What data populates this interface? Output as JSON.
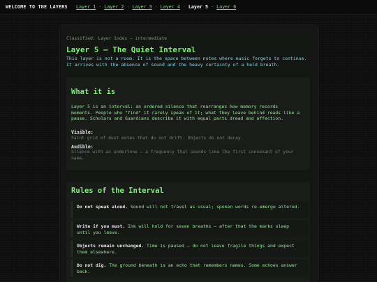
{
  "nav": {
    "brand": "WELCOME TO THE LAYERS",
    "links": [
      {
        "label": "Layer 1",
        "current": false
      },
      {
        "label": "Layer 2",
        "current": false
      },
      {
        "label": "Layer 3",
        "current": false
      },
      {
        "label": "Layer 4",
        "current": false
      },
      {
        "label": "Layer 5",
        "current": true
      },
      {
        "label": "Layer 6",
        "current": false
      }
    ],
    "separator": "·"
  },
  "page": {
    "eyebrow": "Classified: Layer Index — intermediate",
    "title": "Layer 5 — The Quiet Interval",
    "intro": "This layer is not a room. It is the space between notes where music forgets to continue. It arrives with the absence of sound and the heavy certainty of a held breath."
  },
  "what_it_is": {
    "heading": "What it is",
    "body": "Layer 5 is an interval: an ordered silence that rearranges how memory records moments. People who \"find\" it rarely speak of it; what they leave behind reads like a pause. Scholars and Guardians describe it with equal parts dread and affection.",
    "visible_label": "Visible:",
    "visible_text": "Faint grid of dust motes that do not drift. Objects do not decay.",
    "audible_label": "Audible:",
    "audible_text": "Silence with an undertone — a frequency that sounds like the first consonant of your name."
  },
  "rules": {
    "heading": "Rules of the Interval",
    "items": [
      {
        "lead": "Do not speak aloud.",
        "text": "Sound will not travel as usual; spoken words re-emerge altered."
      },
      {
        "lead": "Write if you must.",
        "text": "Ink will hold for seven breaths — after that the marks sleep until you leave."
      },
      {
        "lead": "Objects remain unchanged.",
        "text": "Time is paused — do not leave fragile things and expect them elsewhere."
      },
      {
        "lead": "Do not dig.",
        "text": "The ground beneath is an echo that remembers names. Some echoes answer back."
      }
    ]
  },
  "colors": {
    "accent_green": "#7ff07a",
    "intro_cyan": "#8fd6e8",
    "background": "#0c0d0c"
  }
}
